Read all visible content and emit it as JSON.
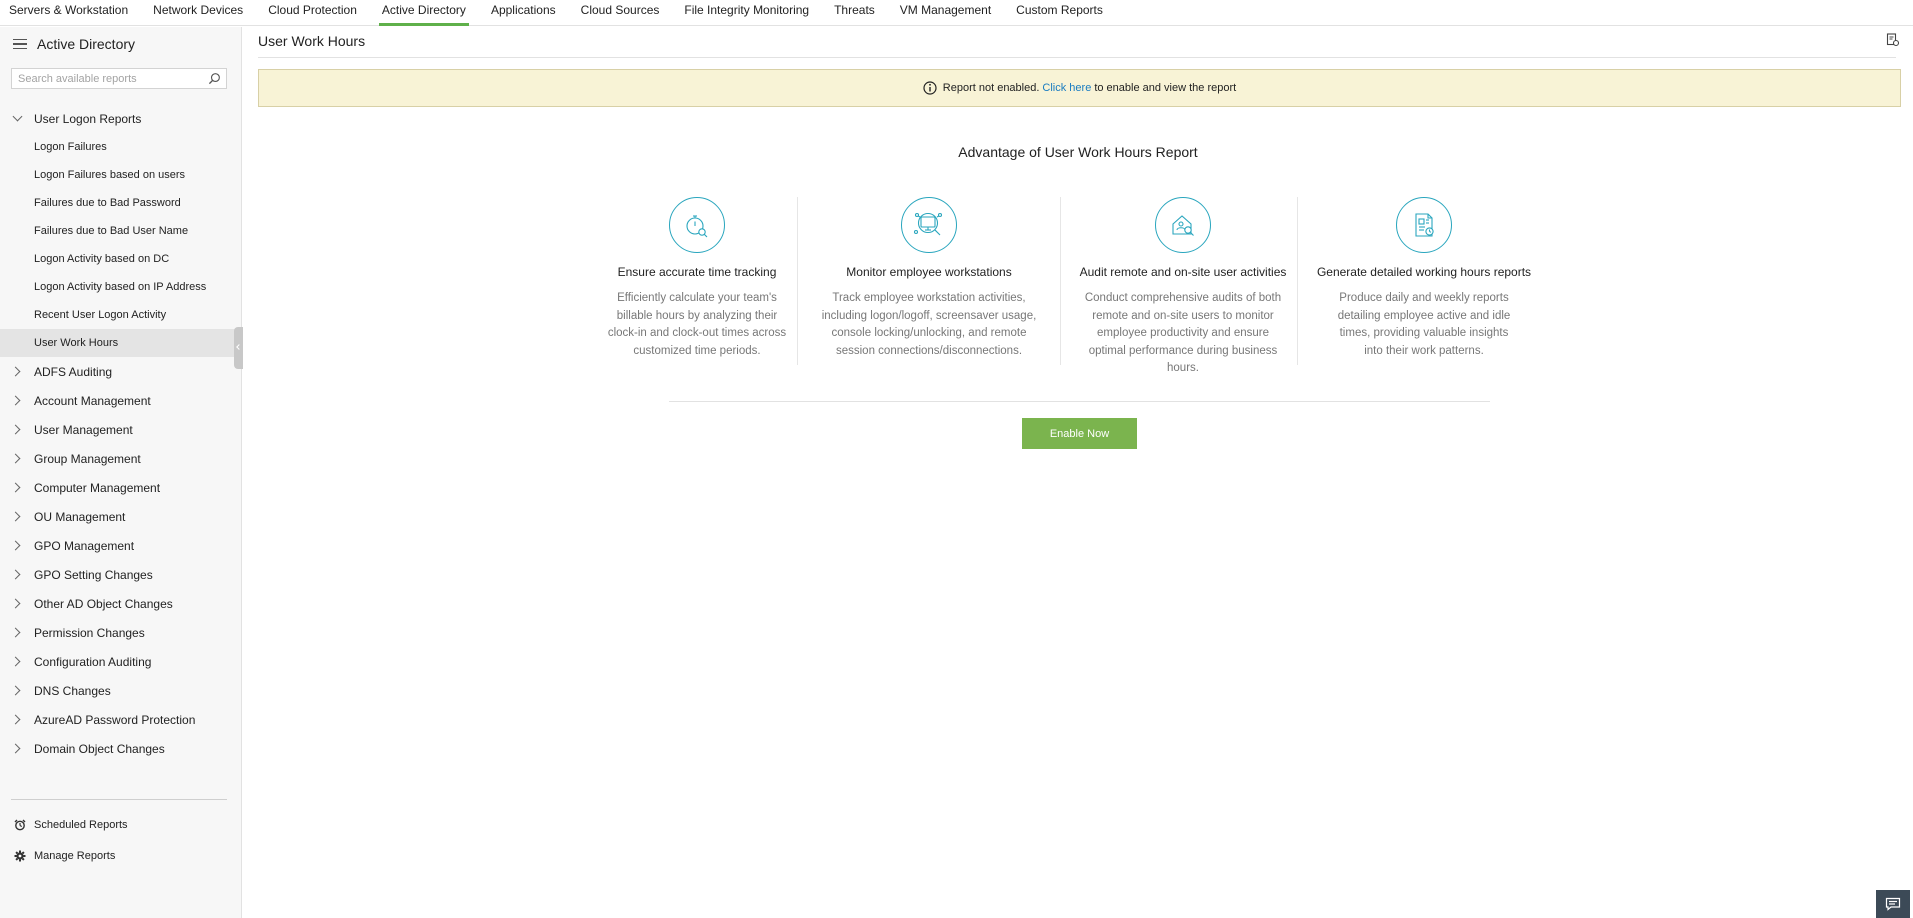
{
  "topnav": {
    "tabs": [
      {
        "label": "Servers & Workstation",
        "active": false
      },
      {
        "label": "Network Devices",
        "active": false
      },
      {
        "label": "Cloud Protection",
        "active": false
      },
      {
        "label": "Active Directory",
        "active": true
      },
      {
        "label": "Applications",
        "active": false
      },
      {
        "label": "Cloud Sources",
        "active": false
      },
      {
        "label": "File Integrity Monitoring",
        "active": false
      },
      {
        "label": "Threats",
        "active": false
      },
      {
        "label": "VM Management",
        "active": false
      },
      {
        "label": "Custom Reports",
        "active": false
      }
    ]
  },
  "sidebar": {
    "title": "Active Directory",
    "search_placeholder": "Search available reports",
    "open_group": {
      "label": "User Logon Reports",
      "items": [
        "Logon Failures",
        "Logon Failures based on users",
        "Failures due to Bad Password",
        "Failures due to Bad User Name",
        "Logon Activity based on DC",
        "Logon Activity based on IP Address",
        "Recent User Logon Activity",
        "User Work Hours"
      ],
      "selected": "User Work Hours"
    },
    "groups": [
      "ADFS Auditing",
      "Account Management",
      "User Management",
      "Group Management",
      "Computer Management",
      "OU Management",
      "GPO Management",
      "GPO Setting Changes",
      "Other AD Object Changes",
      "Permission Changes",
      "Configuration Auditing",
      "DNS Changes",
      "AzureAD Password Protection",
      "Domain Object Changes"
    ],
    "bottom": {
      "scheduled": "Scheduled Reports",
      "manage": "Manage Reports"
    }
  },
  "main": {
    "title": "User Work Hours",
    "banner": {
      "prefix": "Report not enabled.",
      "link": "Click here",
      "suffix": "to enable and view the report"
    },
    "advantage_title": "Advantage of User Work Hours Report",
    "features": [
      {
        "icon": "stopwatch-search-icon",
        "heading": "Ensure accurate time tracking",
        "lines": [
          "Efficiently calculate your team's",
          "billable hours by analyzing their",
          "clock-in and clock-out times across",
          "customized time periods."
        ]
      },
      {
        "icon": "monitor-search-icon",
        "heading": "Monitor employee workstations",
        "lines": [
          "Track employee workstation activities,",
          "including logon/logoff, screensaver usage,",
          "console locking/unlocking, and remote",
          "session connections/disconnections."
        ]
      },
      {
        "icon": "home-user-search-icon",
        "heading": "Audit remote and on-site user activities",
        "lines": [
          "Conduct comprehensive audits of both",
          "remote and on-site users to monitor",
          "employee productivity and ensure",
          "optimal performance during business",
          "hours."
        ]
      },
      {
        "icon": "report-clock-icon",
        "heading": "Generate detailed working hours reports",
        "lines": [
          "Produce daily and weekly reports",
          "detailing employee active and idle",
          "times, providing valuable insights",
          "into their work patterns."
        ]
      }
    ],
    "enable_button": "Enable Now"
  },
  "colors": {
    "accent_green": "#7bb44e",
    "active_tab_underline": "#5fb04a",
    "icon_teal": "#2aa6be",
    "banner_bg": "#f8f3d6",
    "link_blue": "#1a7cc1"
  }
}
